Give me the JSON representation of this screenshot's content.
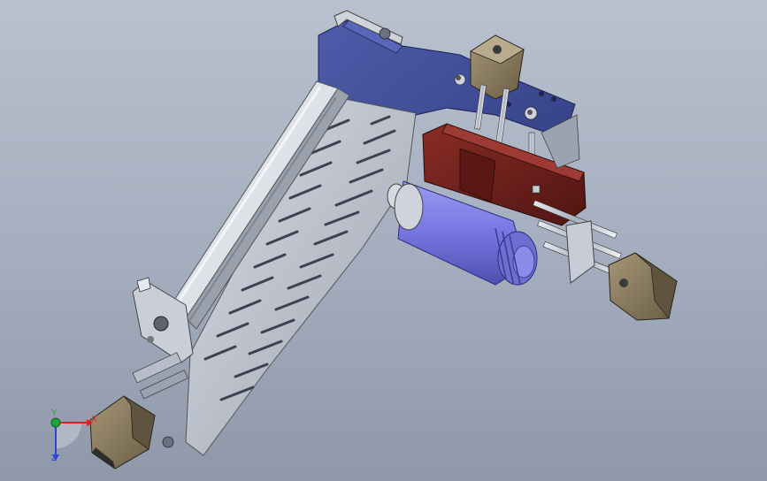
{
  "viewport": {
    "background_top": "#b9c1cf",
    "background_bottom": "#8e98a9"
  },
  "model": {
    "components": [
      "mounting-plate",
      "linear-rail-assembly",
      "slotted-side-plate",
      "upper-stepper-motor",
      "spindle-motor",
      "right-stepper-motor",
      "lower-stepper-motor",
      "carriage-bracket"
    ],
    "colors": {
      "mounting_plate": "#3d4c96",
      "carriage_bracket": "#6b1f1b",
      "spindle": "#7f7fe6",
      "steel": "#c7ccd6",
      "motor_body": "#8a7a5e",
      "motor_dark": "#3a3a3a"
    }
  },
  "triad": {
    "x_label": "X",
    "y_label": "Y",
    "z_label": "Z",
    "x_color": "#e0201c",
    "y_color": "#1fa33a",
    "z_color": "#2b44d6"
  }
}
